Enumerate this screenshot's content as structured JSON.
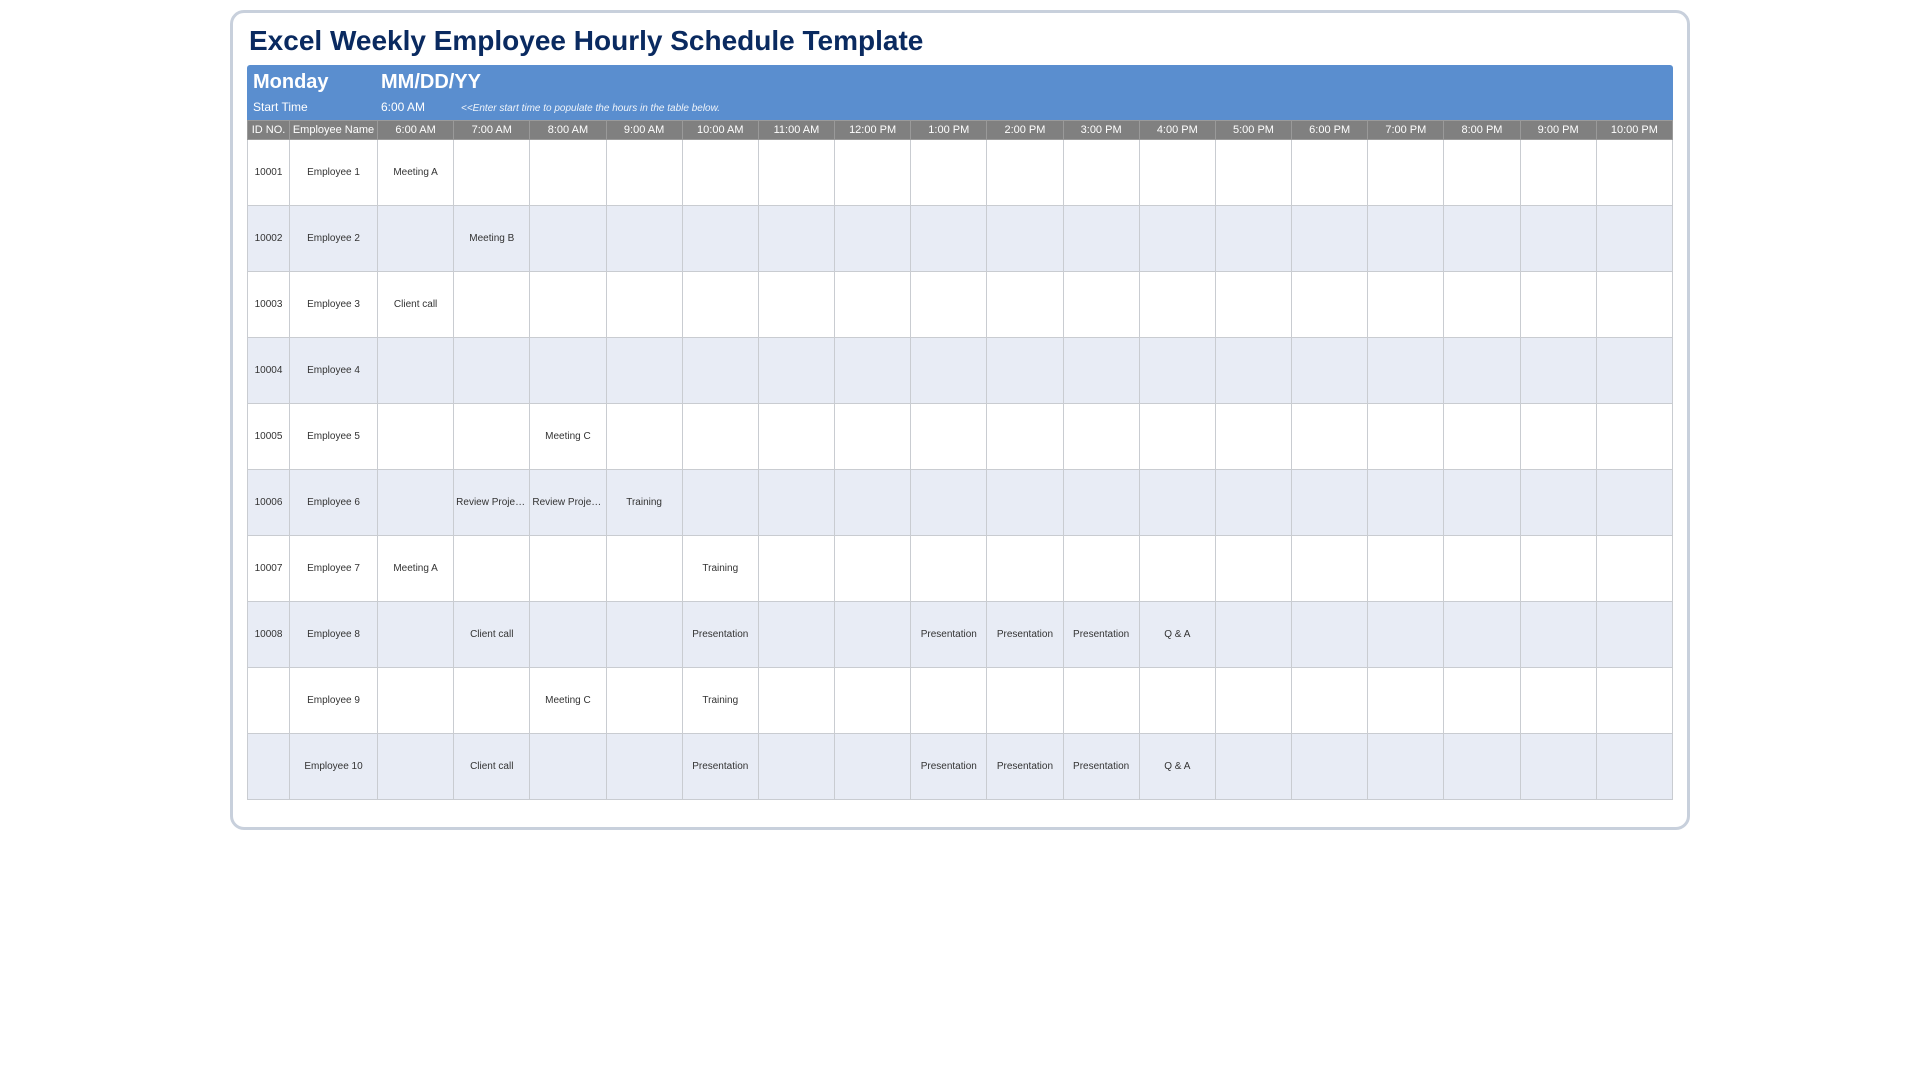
{
  "title": "Excel Weekly Employee Hourly Schedule Template",
  "banner": {
    "day": "Monday",
    "date": "MM/DD/YY",
    "start_label": "Start Time",
    "start_value": "6:00 AM",
    "hint": "<<Enter start time to populate the hours in the table below."
  },
  "headers": {
    "id": "ID NO.",
    "emp": "Employee Name",
    "hours": [
      "6:00 AM",
      "7:00 AM",
      "8:00 AM",
      "9:00 AM",
      "10:00 AM",
      "11:00 AM",
      "12:00 PM",
      "1:00 PM",
      "2:00 PM",
      "3:00 PM",
      "4:00 PM",
      "5:00 PM",
      "6:00 PM",
      "7:00 PM",
      "8:00 PM",
      "9:00 PM",
      "10:00 PM"
    ]
  },
  "rows": [
    {
      "id": "10001",
      "emp": "Employee 1",
      "cells": [
        "Meeting A",
        "",
        "",
        "",
        "",
        "",
        "",
        "",
        "",
        "",
        "",
        "",
        "",
        "",
        "",
        "",
        ""
      ]
    },
    {
      "id": "10002",
      "emp": "Employee 2",
      "cells": [
        "",
        "Meeting B",
        "",
        "",
        "",
        "",
        "",
        "",
        "",
        "",
        "",
        "",
        "",
        "",
        "",
        "",
        ""
      ]
    },
    {
      "id": "10003",
      "emp": "Employee 3",
      "cells": [
        "Client call",
        "",
        "",
        "",
        "",
        "",
        "",
        "",
        "",
        "",
        "",
        "",
        "",
        "",
        "",
        "",
        ""
      ]
    },
    {
      "id": "10004",
      "emp": "Employee 4",
      "cells": [
        "",
        "",
        "",
        "",
        "",
        "",
        "",
        "",
        "",
        "",
        "",
        "",
        "",
        "",
        "",
        "",
        ""
      ]
    },
    {
      "id": "10005",
      "emp": "Employee 5",
      "cells": [
        "",
        "",
        "Meeting C",
        "",
        "",
        "",
        "",
        "",
        "",
        "",
        "",
        "",
        "",
        "",
        "",
        "",
        ""
      ]
    },
    {
      "id": "10006",
      "emp": "Employee 6",
      "cells": [
        "",
        "Review Project A",
        "Review Project B",
        "Training",
        "",
        "",
        "",
        "",
        "",
        "",
        "",
        "",
        "",
        "",
        "",
        "",
        ""
      ]
    },
    {
      "id": "10007",
      "emp": "Employee 7",
      "cells": [
        "Meeting A",
        "",
        "",
        "",
        "Training",
        "",
        "",
        "",
        "",
        "",
        "",
        "",
        "",
        "",
        "",
        "",
        ""
      ]
    },
    {
      "id": "10008",
      "emp": "Employee 8",
      "cells": [
        "",
        "Client call",
        "",
        "",
        "Presentation",
        "",
        "",
        "Presentation",
        "Presentation",
        "Presentation",
        "Q & A",
        "",
        "",
        "",
        "",
        "",
        ""
      ]
    },
    {
      "id": "",
      "emp": "Employee 9",
      "cells": [
        "",
        "",
        "Meeting C",
        "",
        "Training",
        "",
        "",
        "",
        "",
        "",
        "",
        "",
        "",
        "",
        "",
        "",
        ""
      ]
    },
    {
      "id": "",
      "emp": "Employee 10",
      "cells": [
        "",
        "Client call",
        "",
        "",
        "Presentation",
        "",
        "",
        "Presentation",
        "Presentation",
        "Presentation",
        "Q & A",
        "",
        "",
        "",
        "",
        "",
        ""
      ]
    }
  ]
}
